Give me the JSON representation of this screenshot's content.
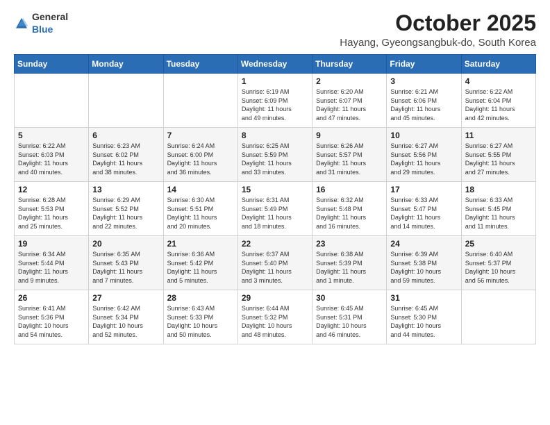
{
  "logo": {
    "general": "General",
    "blue": "Blue"
  },
  "header": {
    "month": "October 2025",
    "location": "Hayang, Gyeongsangbuk-do, South Korea"
  },
  "days_of_week": [
    "Sunday",
    "Monday",
    "Tuesday",
    "Wednesday",
    "Thursday",
    "Friday",
    "Saturday"
  ],
  "weeks": [
    [
      {
        "day": "",
        "info": ""
      },
      {
        "day": "",
        "info": ""
      },
      {
        "day": "",
        "info": ""
      },
      {
        "day": "1",
        "info": "Sunrise: 6:19 AM\nSunset: 6:09 PM\nDaylight: 11 hours\nand 49 minutes."
      },
      {
        "day": "2",
        "info": "Sunrise: 6:20 AM\nSunset: 6:07 PM\nDaylight: 11 hours\nand 47 minutes."
      },
      {
        "day": "3",
        "info": "Sunrise: 6:21 AM\nSunset: 6:06 PM\nDaylight: 11 hours\nand 45 minutes."
      },
      {
        "day": "4",
        "info": "Sunrise: 6:22 AM\nSunset: 6:04 PM\nDaylight: 11 hours\nand 42 minutes."
      }
    ],
    [
      {
        "day": "5",
        "info": "Sunrise: 6:22 AM\nSunset: 6:03 PM\nDaylight: 11 hours\nand 40 minutes."
      },
      {
        "day": "6",
        "info": "Sunrise: 6:23 AM\nSunset: 6:02 PM\nDaylight: 11 hours\nand 38 minutes."
      },
      {
        "day": "7",
        "info": "Sunrise: 6:24 AM\nSunset: 6:00 PM\nDaylight: 11 hours\nand 36 minutes."
      },
      {
        "day": "8",
        "info": "Sunrise: 6:25 AM\nSunset: 5:59 PM\nDaylight: 11 hours\nand 33 minutes."
      },
      {
        "day": "9",
        "info": "Sunrise: 6:26 AM\nSunset: 5:57 PM\nDaylight: 11 hours\nand 31 minutes."
      },
      {
        "day": "10",
        "info": "Sunrise: 6:27 AM\nSunset: 5:56 PM\nDaylight: 11 hours\nand 29 minutes."
      },
      {
        "day": "11",
        "info": "Sunrise: 6:27 AM\nSunset: 5:55 PM\nDaylight: 11 hours\nand 27 minutes."
      }
    ],
    [
      {
        "day": "12",
        "info": "Sunrise: 6:28 AM\nSunset: 5:53 PM\nDaylight: 11 hours\nand 25 minutes."
      },
      {
        "day": "13",
        "info": "Sunrise: 6:29 AM\nSunset: 5:52 PM\nDaylight: 11 hours\nand 22 minutes."
      },
      {
        "day": "14",
        "info": "Sunrise: 6:30 AM\nSunset: 5:51 PM\nDaylight: 11 hours\nand 20 minutes."
      },
      {
        "day": "15",
        "info": "Sunrise: 6:31 AM\nSunset: 5:49 PM\nDaylight: 11 hours\nand 18 minutes."
      },
      {
        "day": "16",
        "info": "Sunrise: 6:32 AM\nSunset: 5:48 PM\nDaylight: 11 hours\nand 16 minutes."
      },
      {
        "day": "17",
        "info": "Sunrise: 6:33 AM\nSunset: 5:47 PM\nDaylight: 11 hours\nand 14 minutes."
      },
      {
        "day": "18",
        "info": "Sunrise: 6:33 AM\nSunset: 5:45 PM\nDaylight: 11 hours\nand 11 minutes."
      }
    ],
    [
      {
        "day": "19",
        "info": "Sunrise: 6:34 AM\nSunset: 5:44 PM\nDaylight: 11 hours\nand 9 minutes."
      },
      {
        "day": "20",
        "info": "Sunrise: 6:35 AM\nSunset: 5:43 PM\nDaylight: 11 hours\nand 7 minutes."
      },
      {
        "day": "21",
        "info": "Sunrise: 6:36 AM\nSunset: 5:42 PM\nDaylight: 11 hours\nand 5 minutes."
      },
      {
        "day": "22",
        "info": "Sunrise: 6:37 AM\nSunset: 5:40 PM\nDaylight: 11 hours\nand 3 minutes."
      },
      {
        "day": "23",
        "info": "Sunrise: 6:38 AM\nSunset: 5:39 PM\nDaylight: 11 hours\nand 1 minute."
      },
      {
        "day": "24",
        "info": "Sunrise: 6:39 AM\nSunset: 5:38 PM\nDaylight: 10 hours\nand 59 minutes."
      },
      {
        "day": "25",
        "info": "Sunrise: 6:40 AM\nSunset: 5:37 PM\nDaylight: 10 hours\nand 56 minutes."
      }
    ],
    [
      {
        "day": "26",
        "info": "Sunrise: 6:41 AM\nSunset: 5:36 PM\nDaylight: 10 hours\nand 54 minutes."
      },
      {
        "day": "27",
        "info": "Sunrise: 6:42 AM\nSunset: 5:34 PM\nDaylight: 10 hours\nand 52 minutes."
      },
      {
        "day": "28",
        "info": "Sunrise: 6:43 AM\nSunset: 5:33 PM\nDaylight: 10 hours\nand 50 minutes."
      },
      {
        "day": "29",
        "info": "Sunrise: 6:44 AM\nSunset: 5:32 PM\nDaylight: 10 hours\nand 48 minutes."
      },
      {
        "day": "30",
        "info": "Sunrise: 6:45 AM\nSunset: 5:31 PM\nDaylight: 10 hours\nand 46 minutes."
      },
      {
        "day": "31",
        "info": "Sunrise: 6:45 AM\nSunset: 5:30 PM\nDaylight: 10 hours\nand 44 minutes."
      },
      {
        "day": "",
        "info": ""
      }
    ]
  ]
}
